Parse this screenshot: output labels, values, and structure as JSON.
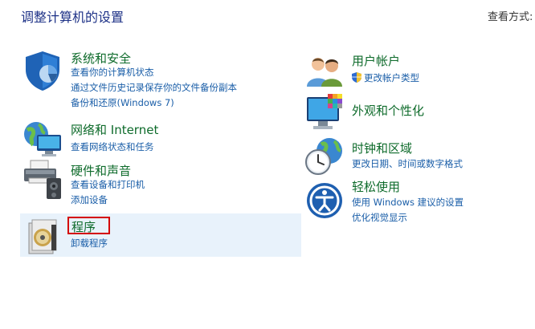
{
  "header": {
    "title": "调整计算机的设置",
    "view_by": "查看方式:"
  },
  "left": [
    {
      "title": "系统和安全",
      "links": [
        "查看你的计算机状态",
        "通过文件历史记录保存你的文件备份副本",
        "备份和还原(Windows 7)"
      ],
      "icon": "shield-icon"
    },
    {
      "title": "网络和 Internet",
      "links": [
        "查看网络状态和任务"
      ],
      "icon": "network-globe-icon"
    },
    {
      "title": "硬件和声音",
      "links": [
        "查看设备和打印机",
        "添加设备"
      ],
      "icon": "printer-icon"
    },
    {
      "title": "程序",
      "links": [
        "卸载程序"
      ],
      "icon": "programs-disc-icon"
    }
  ],
  "right": [
    {
      "title": "用户帐户",
      "links": [
        "更改帐户类型"
      ],
      "icon": "users-icon"
    },
    {
      "title": "外观和个性化",
      "links": [],
      "icon": "monitor-palette-icon"
    },
    {
      "title": "时钟和区域",
      "links": [
        "更改日期、时间或数字格式"
      ],
      "icon": "clock-globe-icon"
    },
    {
      "title": "轻松使用",
      "links": [
        "使用 Windows 建议的设置",
        "优化视觉显示"
      ],
      "icon": "ease-of-access-icon"
    }
  ]
}
